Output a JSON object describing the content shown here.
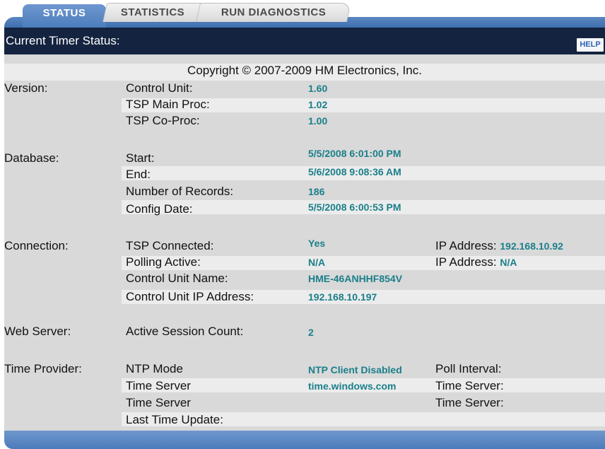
{
  "tabs": [
    {
      "label": "STATUS",
      "active": true
    },
    {
      "label": "STATISTICS",
      "active": false
    },
    {
      "label": "RUN DIAGNOSTICS",
      "active": false
    }
  ],
  "header": {
    "title": "Current Timer Status:",
    "help_label": "HELP"
  },
  "copyright": "Copyright © 2007-2009 HM Electronics, Inc.",
  "version": {
    "section_label": "Version:",
    "control_unit_label": "Control Unit:",
    "control_unit_value": "1.60",
    "tsp_main_label": "TSP Main Proc:",
    "tsp_main_value": "1.02",
    "tsp_co_label": "TSP Co-Proc:",
    "tsp_co_value": "1.00"
  },
  "database": {
    "section_label": "Database:",
    "start_label": "Start:",
    "start_value": "5/5/2008 6:01:00 PM",
    "end_label": "End:",
    "end_value": "5/6/2008 9:08:36 AM",
    "records_label": "Number of Records:",
    "records_value": "186",
    "config_label": "Config Date:",
    "config_value": "5/5/2008 6:00:53 PM"
  },
  "connection": {
    "section_label": "Connection:",
    "tsp_connected_label": "TSP Connected:",
    "tsp_connected_value": "Yes",
    "ip1_label": "IP Address:",
    "ip1_value": "192.168.10.92",
    "polling_label": "Polling Active:",
    "polling_value": "N/A",
    "ip2_label": "IP Address:",
    "ip2_value": "N/A",
    "cu_name_label": "Control Unit Name:",
    "cu_name_value": "HME-46ANHHF854V",
    "cu_ip_label": "Control Unit IP Address:",
    "cu_ip_value": "192.168.10.197"
  },
  "web_server": {
    "section_label": "Web Server:",
    "session_label": "Active Session Count:",
    "session_value": "2"
  },
  "time_provider": {
    "section_label": "Time Provider:",
    "ntp_label": "NTP Mode",
    "ntp_value": "NTP Client Disabled",
    "poll_label": "Poll Interval:",
    "ts1_label": "Time Server",
    "ts1_value": "time.windows.com",
    "ts1_right_label": "Time Server:",
    "ts2_label": "Time Server",
    "ts2_right_label": "Time Server:",
    "last_update_label": "Last Time Update:"
  },
  "colors": {
    "header_bg": "#14233f",
    "tab_blue": "#4c7dbd",
    "value_teal": "#1a7f8a",
    "panel_gray": "#d9d9d9",
    "stripe_gray": "#ececec"
  }
}
